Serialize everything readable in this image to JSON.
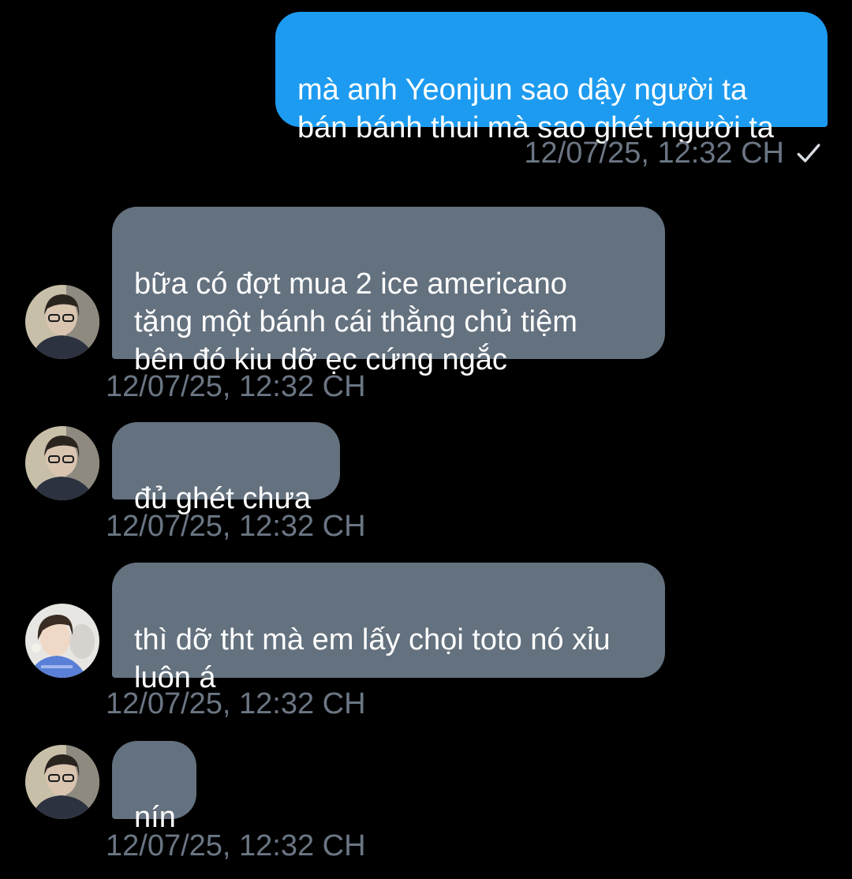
{
  "conversation": {
    "messages": [
      {
        "direction": "outgoing",
        "text": "mà anh Yeonjun sao dậy người ta\nbán bánh thui mà sao ghét người ta",
        "timestamp": "12/07/25, 12:32 CH",
        "status_icon": "check-icon"
      },
      {
        "direction": "incoming",
        "text": "bữa có đợt mua 2 ice americano\ntặng một bánh cái thằng chủ tiệm\nbên đó kiu dỡ ẹc cứng ngắc",
        "timestamp": "12/07/25, 12:32 CH",
        "avatar": "avatar-a"
      },
      {
        "direction": "incoming",
        "text": "đủ ghét chưa",
        "timestamp": "12/07/25, 12:32 CH",
        "avatar": "avatar-a"
      },
      {
        "direction": "incoming",
        "text": "thì dỡ tht mà em lấy chọi toto nó xỉu\nluôn á",
        "timestamp": "12/07/25, 12:32 CH",
        "avatar": "avatar-b"
      },
      {
        "direction": "incoming",
        "text": "nín",
        "timestamp": "12/07/25, 12:32 CH",
        "avatar": "avatar-a"
      }
    ]
  },
  "colors": {
    "background": "#000000",
    "outgoing_bubble": "#1d9bf0",
    "incoming_bubble": "#64717f",
    "timestamp_text": "#6b7684",
    "message_text": "#ffffff"
  }
}
